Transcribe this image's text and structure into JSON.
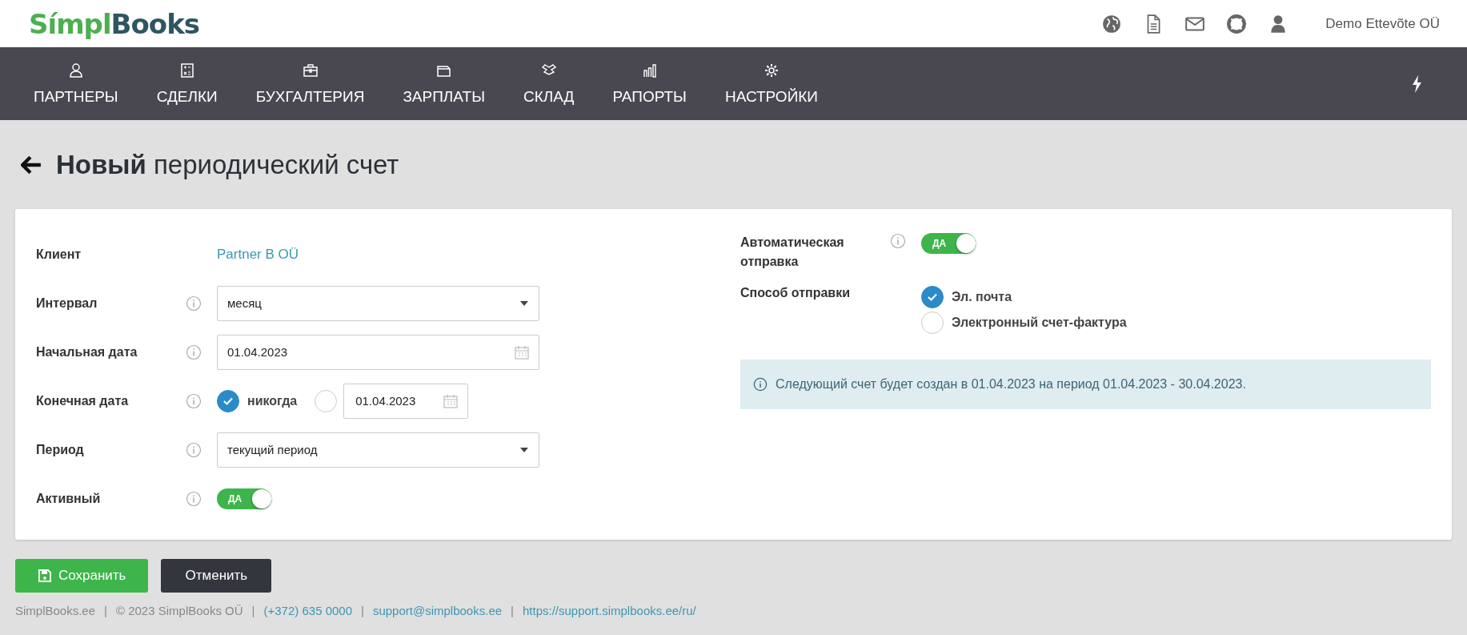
{
  "header": {
    "logo": {
      "first": "Símpl",
      "second": "Books"
    },
    "icons": [
      {
        "kind": "globe"
      },
      {
        "kind": "document"
      },
      {
        "kind": "mail"
      },
      {
        "kind": "lifebuoy"
      },
      {
        "kind": "user"
      }
    ],
    "company": "Demo Ettevõte OÜ"
  },
  "nav": {
    "items": [
      {
        "label": "ПАРТНЕРЫ"
      },
      {
        "label": "СДЕЛКИ"
      },
      {
        "label": "БУХГАЛТЕРИЯ"
      },
      {
        "label": "ЗАРПЛАТЫ"
      },
      {
        "label": "СКЛАД"
      },
      {
        "label": "РАПОРТЫ"
      },
      {
        "label": "НАСТРОЙКИ"
      }
    ]
  },
  "page_title": "**Новый** периодический счет",
  "form_left": [
    {
      "kind": "link",
      "label": "Клиент",
      "value": "Partner B OÜ"
    },
    {
      "kind": "select",
      "label": "Интервал",
      "value": "месяц"
    },
    {
      "kind": "date",
      "label": "Начальная дата",
      "value": "01.04.2023"
    },
    {
      "kind": "enddate",
      "label": "Конечная дата",
      "never": {
        "label": "никогда",
        "selected": true
      },
      "date": {
        "selected": false,
        "value": "01.04.2023"
      }
    },
    {
      "kind": "select",
      "label": "Период",
      "value": "текущий период"
    },
    {
      "kind": "toggle",
      "label": "Активный",
      "toggle": {
        "label": "ДА",
        "on": true
      }
    }
  ],
  "form_right": {
    "auto_send": {
      "label": "Автоматическая отправка",
      "toggle": {
        "label": "ДА",
        "on": true
      }
    },
    "send_method": {
      "label": "Способ отправки",
      "options": [
        {
          "label": "Эл. почта",
          "selected": true
        },
        {
          "label": "Электронный счет-фактура",
          "selected": false
        }
      ]
    },
    "info": "Следующий счет будет создан в 01.04.2023 на период 01.04.2023 - 30.04.2023."
  },
  "buttons": [
    {
      "kind": "primary",
      "label": "Сохранить"
    },
    {
      "kind": "dark",
      "label": "Отменить"
    }
  ],
  "footer": [
    {
      "kind": "text",
      "text": "SimplBooks.ee"
    },
    {
      "kind": "separator",
      "text": "|"
    },
    {
      "kind": "text",
      "text": "© 2023 SimplBooks OÜ"
    },
    {
      "kind": "separator",
      "text": "|"
    },
    {
      "kind": "link",
      "text": "(+372) 635 0000"
    },
    {
      "kind": "separator",
      "text": "|"
    },
    {
      "kind": "link",
      "text": "support@simplbooks.ee"
    },
    {
      "kind": "separator",
      "text": "|"
    },
    {
      "kind": "link",
      "text": "https://support.simplbooks.ee/ru/"
    }
  ]
}
